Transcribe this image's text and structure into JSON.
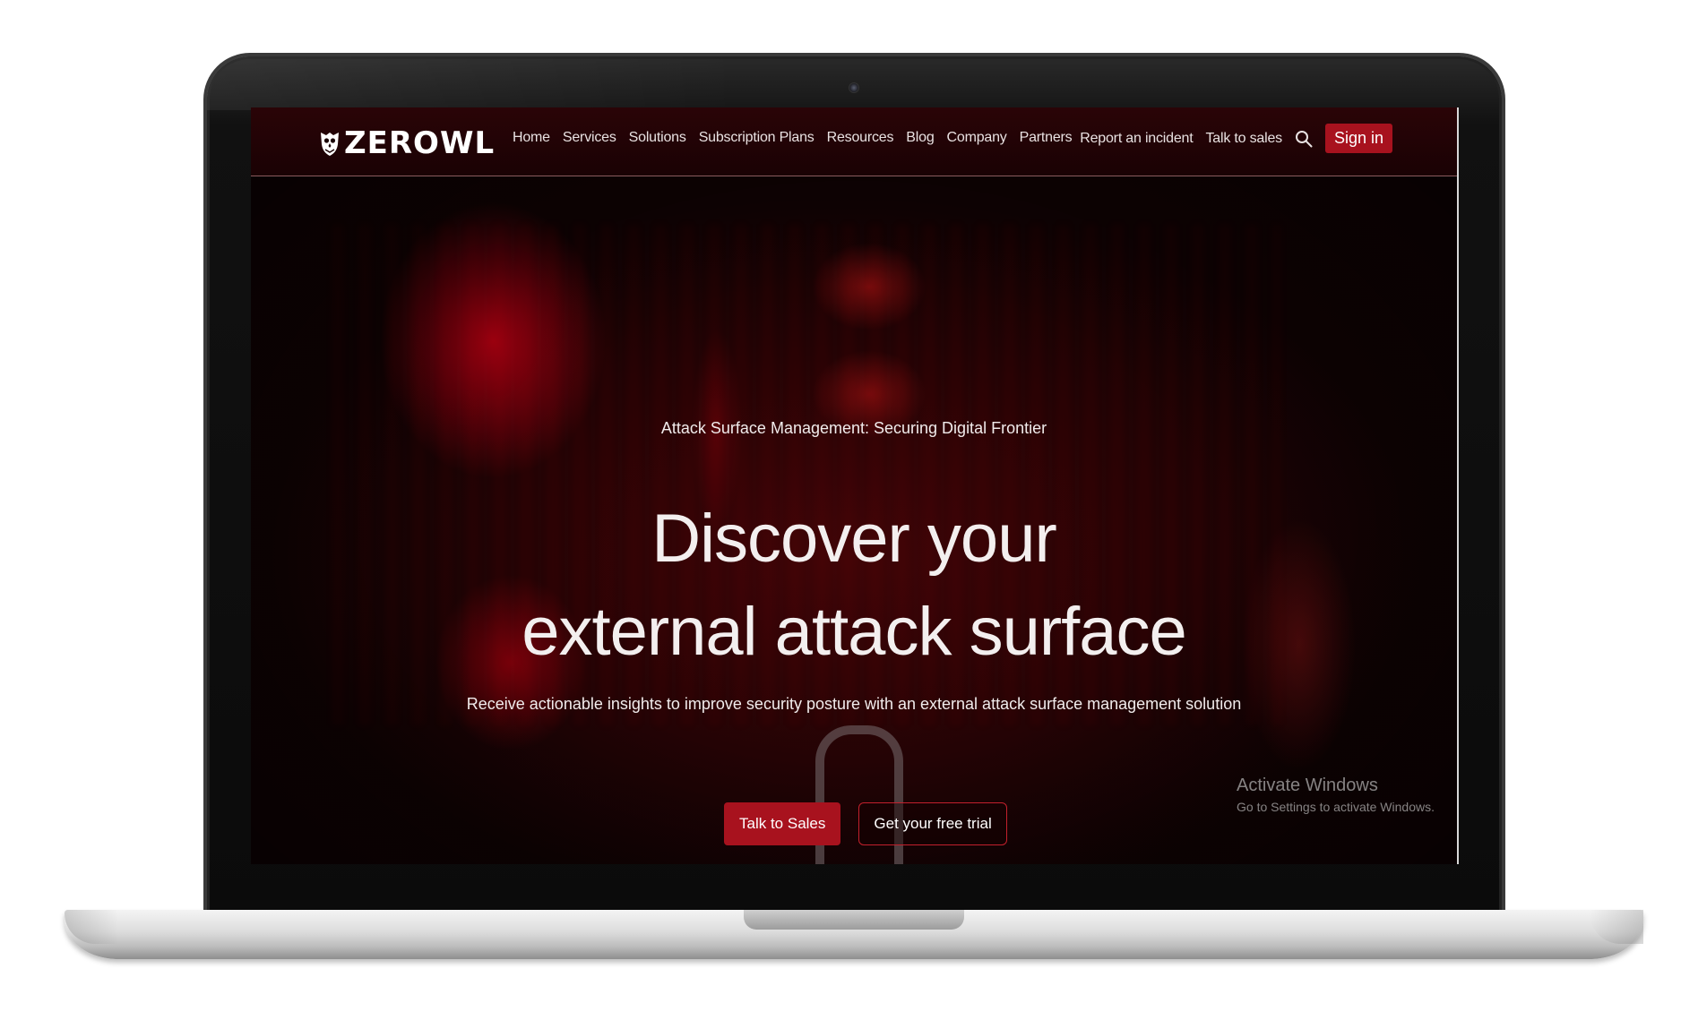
{
  "brand": {
    "name": "ZEROWL",
    "logo_icon": "owl-shield-icon"
  },
  "nav": {
    "links": [
      "Home",
      "Services",
      "Solutions",
      "Subscription Plans",
      "Resources",
      "Blog",
      "Company",
      "Partners"
    ],
    "report_incident": "Report an incident",
    "talk_to_sales": "Talk to sales",
    "search_icon": "search-icon",
    "sign_in": "Sign in"
  },
  "hero": {
    "eyebrow": "Attack Surface Management: Securing Digital Frontier",
    "headline_line1": "Discover your",
    "headline_line2": "external attack surface",
    "subheadline": "Receive actionable insights to improve security posture with an external attack surface management solution",
    "cta_primary": "Talk to Sales",
    "cta_secondary": "Get your free trial"
  },
  "watermark": {
    "title": "Activate Windows",
    "subtitle": "Go to Settings to activate Windows."
  },
  "colors": {
    "accent": "#a8121e",
    "background": "#0a0303",
    "text": "#f1ecec"
  }
}
